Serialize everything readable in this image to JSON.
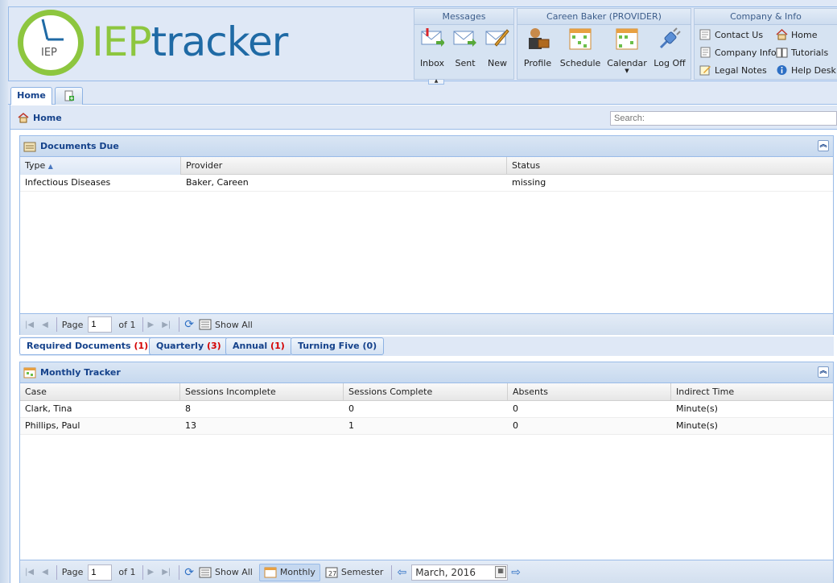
{
  "header": {
    "logo_badge": "IEP",
    "logo_iep": "IEP",
    "logo_tracker": "tracker",
    "groups": {
      "messages": {
        "title": "Messages",
        "buttons": [
          "Inbox",
          "Sent",
          "New"
        ]
      },
      "provider": {
        "title": "Careen Baker (PROVIDER)",
        "buttons": [
          "Profile",
          "Schedule",
          "Calendar",
          "Log Off"
        ]
      },
      "company": {
        "title": "Company & Info",
        "links": [
          "Contact Us",
          "Home",
          "Company Info",
          "Tutorials",
          "Legal Notes",
          "Help Desk"
        ]
      }
    }
  },
  "tabs": {
    "home": "Home"
  },
  "breadcrumb": "Home",
  "search": {
    "placeholder": "Search:"
  },
  "documents_due": {
    "title": "Documents Due",
    "columns": [
      "Type",
      "Provider",
      "Status"
    ],
    "rows": [
      [
        "Infectious Diseases",
        "Baker, Careen",
        "missing"
      ]
    ],
    "pager": {
      "page_label": "Page",
      "page_value": "1",
      "of_label": "of 1",
      "show_all": "Show All"
    }
  },
  "doc_tabs": [
    {
      "label": "Required Documents",
      "count": "(1)"
    },
    {
      "label": "Quarterly",
      "count": "(3)"
    },
    {
      "label": "Annual",
      "count": "(1)"
    },
    {
      "label": "Turning Five",
      "count": "(0)"
    }
  ],
  "monthly_tracker": {
    "title": "Monthly Tracker",
    "columns": [
      "Case",
      "Sessions Incomplete",
      "Sessions Complete",
      "Absents",
      "Indirect Time"
    ],
    "rows": [
      [
        "Clark, Tina",
        "8",
        "0",
        "0",
        "Minute(s)"
      ],
      [
        "Phillips, Paul",
        "13",
        "1",
        "0",
        "Minute(s)"
      ]
    ],
    "pager": {
      "page_label": "Page",
      "page_value": "1",
      "of_label": "of 1",
      "show_all": "Show All",
      "monthly": "Monthly",
      "semester": "Semester",
      "date": "March, 2016"
    }
  },
  "colors": {
    "brand_green": "#8dc63f",
    "brand_blue": "#1f6aa5",
    "header_blue": "#15428b",
    "count_red": "#d40000"
  }
}
